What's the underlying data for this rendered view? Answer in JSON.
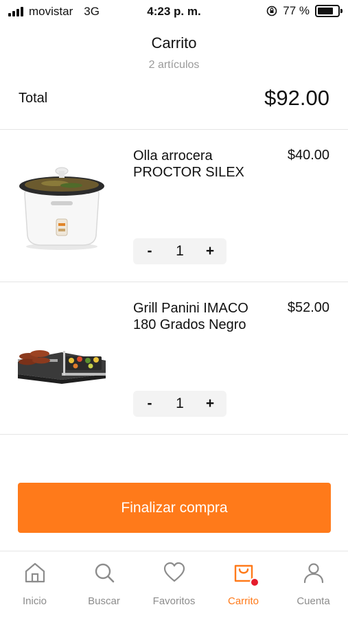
{
  "status_bar": {
    "carrier": "movistar",
    "network": "3G",
    "time": "4:23 p. m.",
    "battery_text": "77 %",
    "battery_level": 0.77
  },
  "header": {
    "title": "Carrito",
    "subtitle": "2 artículos"
  },
  "summary": {
    "total_label": "Total",
    "total_value": "$92.00"
  },
  "items": [
    {
      "name": "Olla arrocera PROCTOR SILEX",
      "price": "$40.00",
      "quantity": "1",
      "minus": "-",
      "plus": "+"
    },
    {
      "name": "Grill Panini IMACO 180 Grados Negro",
      "price": "$52.00",
      "quantity": "1",
      "minus": "-",
      "plus": "+"
    }
  ],
  "checkout": {
    "label": "Finalizar compra"
  },
  "tabbar": {
    "tabs": [
      {
        "label": "Inicio",
        "icon": "home-icon"
      },
      {
        "label": "Buscar",
        "icon": "search-icon"
      },
      {
        "label": "Favoritos",
        "icon": "heart-icon"
      },
      {
        "label": "Carrito",
        "icon": "shopping-bag-icon"
      },
      {
        "label": "Cuenta",
        "icon": "user-icon"
      }
    ],
    "active_index": 3
  },
  "colors": {
    "accent": "#ff7a1a",
    "badge": "#e51c2c",
    "muted": "#8c8c8c"
  }
}
